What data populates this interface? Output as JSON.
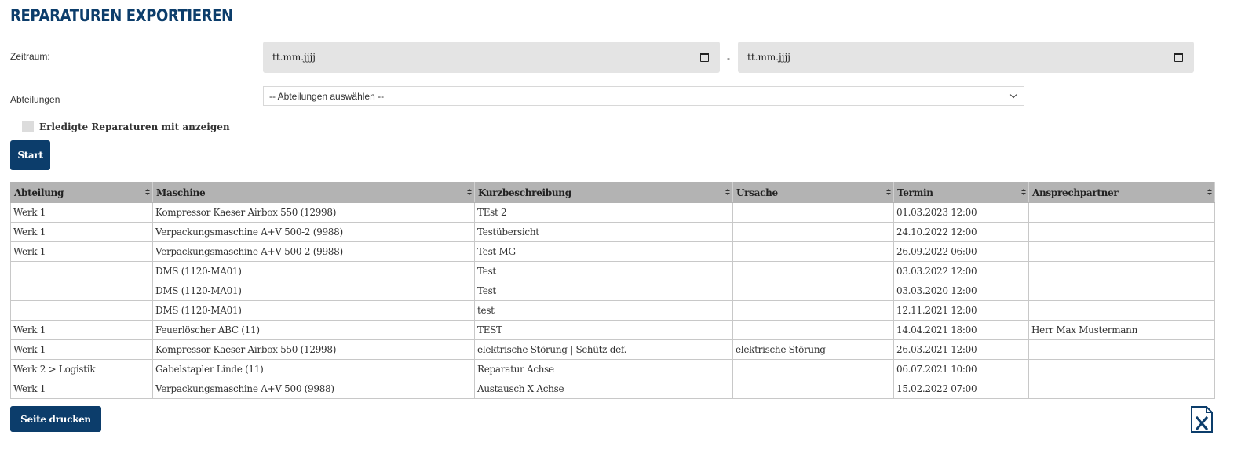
{
  "page": {
    "title": "REPARATUREN EXPORTIEREN"
  },
  "filters": {
    "zeitraum_label": "Zeitraum:",
    "date_from_placeholder": "tt.mm.jjjj",
    "date_separator": "-",
    "date_to_placeholder": "tt.mm.jjjj",
    "abteilungen_label": "Abteilungen",
    "abteilungen_selected": "-- Abteilungen auswählen --",
    "erledigte_label": "Erledigte Reparaturen mit anzeigen",
    "erledigte_checked": false,
    "start_label": "Start"
  },
  "table": {
    "headers": [
      "Abteilung",
      "Maschine",
      "Kurzbeschreibung",
      "Ursache",
      "Termin",
      "Ansprechpartner"
    ],
    "rows": [
      [
        "Werk 1",
        "Kompressor Kaeser Airbox 550 (12998)",
        "TEst 2",
        "",
        "01.03.2023 12:00",
        ""
      ],
      [
        "Werk 1",
        "Verpackungsmaschine A+V 500-2 (9988)",
        "Testübersicht",
        "",
        "24.10.2022 12:00",
        ""
      ],
      [
        "Werk 1",
        "Verpackungsmaschine A+V 500-2 (9988)",
        "Test MG",
        "",
        "26.09.2022 06:00",
        ""
      ],
      [
        "",
        "DMS (1120-MA01)",
        "Test",
        "",
        "03.03.2022 12:00",
        ""
      ],
      [
        "",
        "DMS (1120-MA01)",
        "Test",
        "",
        "03.03.2020 12:00",
        ""
      ],
      [
        "",
        "DMS (1120-MA01)",
        "test",
        "",
        "12.11.2021 12:00",
        ""
      ],
      [
        "Werk 1",
        "Feuerlöscher ABC (11)",
        "TEST",
        "",
        "14.04.2021 18:00",
        "Herr Max Mustermann"
      ],
      [
        "Werk 1",
        "Kompressor Kaeser Airbox 550 (12998)",
        "elektrische Störung | Schütz def.",
        "elektrische Störung",
        "26.03.2021 12:00",
        ""
      ],
      [
        "Werk 2 > Logistik",
        "Gabelstapler Linde (11)",
        "Reparatur Achse",
        "",
        "06.07.2021 10:00",
        ""
      ],
      [
        "Werk 1",
        "Verpackungsmaschine A+V 500 (9988)",
        "Austausch X Achse",
        "",
        "15.02.2022 07:00",
        ""
      ]
    ]
  },
  "actions": {
    "print_label": "Seite drucken",
    "excel_icon": "excel-export-icon"
  },
  "colors": {
    "accent": "#0c3d6b",
    "header_bg": "#b3b3b3",
    "input_bg": "#e4e4e4"
  }
}
